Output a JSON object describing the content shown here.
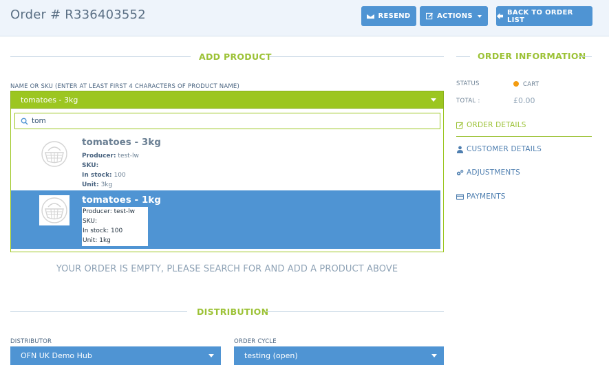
{
  "header": {
    "title": "Order # R336403552",
    "buttons": {
      "resend": "RESEND",
      "actions": "ACTIONS",
      "back": "BACK TO ORDER LIST"
    }
  },
  "add_product": {
    "section_title": "ADD PRODUCT",
    "field_label": "NAME OR SKU (ENTER AT LEAST FIRST 4 CHARACTERS OF PRODUCT NAME)",
    "selected_value": "tomatoes - 3kg",
    "search_value": "tom",
    "results": [
      {
        "name": "tomatoes - 3kg",
        "producer_label": "Producer:",
        "producer": "test-lw",
        "sku_label": "SKU:",
        "sku": "",
        "stock_label": "In stock:",
        "stock": "100",
        "unit_label": "Unit:",
        "unit": "3kg",
        "highlighted": false
      },
      {
        "name": "tomatoes - 1kg",
        "producer_label": "Producer:",
        "producer": "test-lw",
        "sku_label": "SKU:",
        "sku": "",
        "stock_label": "In stock:",
        "stock": "100",
        "unit_label": "Unit:",
        "unit": "1kg",
        "highlighted": true
      }
    ],
    "empty_message": "YOUR ORDER IS EMPTY, PLEASE SEARCH FOR AND ADD A PRODUCT ABOVE"
  },
  "distribution": {
    "section_title": "DISTRIBUTION",
    "distributor_label": "DISTRIBUTOR",
    "distributor_value": "OFN UK Demo Hub",
    "order_cycle_label": "ORDER CYCLE",
    "order_cycle_value": "testing (open)"
  },
  "order_information": {
    "section_title": "ORDER INFORMATION",
    "status_label": "STATUS",
    "status_value": "CART",
    "total_label": "TOTAL :",
    "total_value": "£0.00",
    "links": {
      "order_details": "ORDER DETAILS",
      "customer_details": "CUSTOMER DETAILS",
      "adjustments": "ADJUSTMENTS",
      "payments": "PAYMENTS"
    }
  },
  "colors": {
    "accent_green": "#9cc620",
    "primary_blue": "#4f94d3",
    "status_cart": "#f39c12"
  },
  "icons": [
    "envelope-icon",
    "edit-icon",
    "arrow-left-icon",
    "search-icon",
    "basket-icon",
    "edit-icon",
    "user-icon",
    "cogs-icon",
    "credit-card-icon"
  ]
}
